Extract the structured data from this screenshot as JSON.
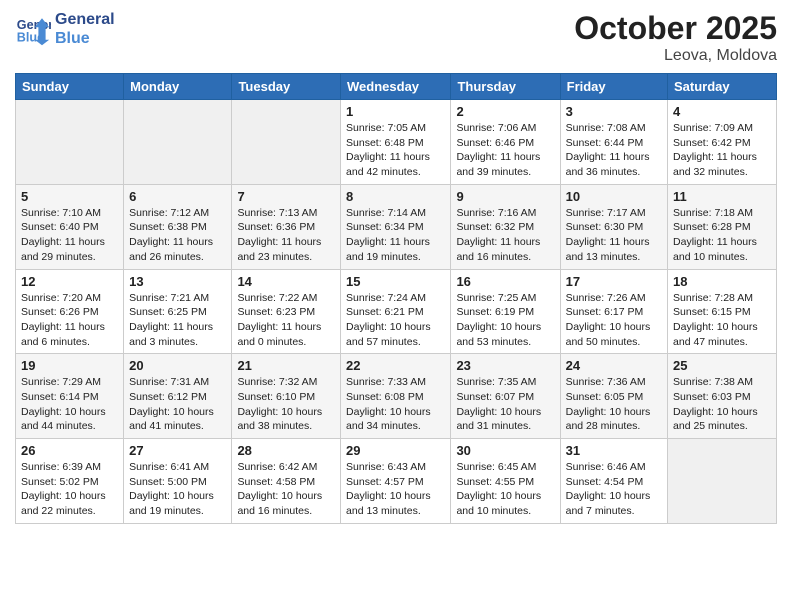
{
  "header": {
    "logo_general": "General",
    "logo_blue": "Blue",
    "month_year": "October 2025",
    "location": "Leova, Moldova"
  },
  "days_of_week": [
    "Sunday",
    "Monday",
    "Tuesday",
    "Wednesday",
    "Thursday",
    "Friday",
    "Saturday"
  ],
  "weeks": [
    [
      {
        "day": "",
        "info": ""
      },
      {
        "day": "",
        "info": ""
      },
      {
        "day": "",
        "info": ""
      },
      {
        "day": "1",
        "info": "Sunrise: 7:05 AM\nSunset: 6:48 PM\nDaylight: 11 hours and 42 minutes."
      },
      {
        "day": "2",
        "info": "Sunrise: 7:06 AM\nSunset: 6:46 PM\nDaylight: 11 hours and 39 minutes."
      },
      {
        "day": "3",
        "info": "Sunrise: 7:08 AM\nSunset: 6:44 PM\nDaylight: 11 hours and 36 minutes."
      },
      {
        "day": "4",
        "info": "Sunrise: 7:09 AM\nSunset: 6:42 PM\nDaylight: 11 hours and 32 minutes."
      }
    ],
    [
      {
        "day": "5",
        "info": "Sunrise: 7:10 AM\nSunset: 6:40 PM\nDaylight: 11 hours and 29 minutes."
      },
      {
        "day": "6",
        "info": "Sunrise: 7:12 AM\nSunset: 6:38 PM\nDaylight: 11 hours and 26 minutes."
      },
      {
        "day": "7",
        "info": "Sunrise: 7:13 AM\nSunset: 6:36 PM\nDaylight: 11 hours and 23 minutes."
      },
      {
        "day": "8",
        "info": "Sunrise: 7:14 AM\nSunset: 6:34 PM\nDaylight: 11 hours and 19 minutes."
      },
      {
        "day": "9",
        "info": "Sunrise: 7:16 AM\nSunset: 6:32 PM\nDaylight: 11 hours and 16 minutes."
      },
      {
        "day": "10",
        "info": "Sunrise: 7:17 AM\nSunset: 6:30 PM\nDaylight: 11 hours and 13 minutes."
      },
      {
        "day": "11",
        "info": "Sunrise: 7:18 AM\nSunset: 6:28 PM\nDaylight: 11 hours and 10 minutes."
      }
    ],
    [
      {
        "day": "12",
        "info": "Sunrise: 7:20 AM\nSunset: 6:26 PM\nDaylight: 11 hours and 6 minutes."
      },
      {
        "day": "13",
        "info": "Sunrise: 7:21 AM\nSunset: 6:25 PM\nDaylight: 11 hours and 3 minutes."
      },
      {
        "day": "14",
        "info": "Sunrise: 7:22 AM\nSunset: 6:23 PM\nDaylight: 11 hours and 0 minutes."
      },
      {
        "day": "15",
        "info": "Sunrise: 7:24 AM\nSunset: 6:21 PM\nDaylight: 10 hours and 57 minutes."
      },
      {
        "day": "16",
        "info": "Sunrise: 7:25 AM\nSunset: 6:19 PM\nDaylight: 10 hours and 53 minutes."
      },
      {
        "day": "17",
        "info": "Sunrise: 7:26 AM\nSunset: 6:17 PM\nDaylight: 10 hours and 50 minutes."
      },
      {
        "day": "18",
        "info": "Sunrise: 7:28 AM\nSunset: 6:15 PM\nDaylight: 10 hours and 47 minutes."
      }
    ],
    [
      {
        "day": "19",
        "info": "Sunrise: 7:29 AM\nSunset: 6:14 PM\nDaylight: 10 hours and 44 minutes."
      },
      {
        "day": "20",
        "info": "Sunrise: 7:31 AM\nSunset: 6:12 PM\nDaylight: 10 hours and 41 minutes."
      },
      {
        "day": "21",
        "info": "Sunrise: 7:32 AM\nSunset: 6:10 PM\nDaylight: 10 hours and 38 minutes."
      },
      {
        "day": "22",
        "info": "Sunrise: 7:33 AM\nSunset: 6:08 PM\nDaylight: 10 hours and 34 minutes."
      },
      {
        "day": "23",
        "info": "Sunrise: 7:35 AM\nSunset: 6:07 PM\nDaylight: 10 hours and 31 minutes."
      },
      {
        "day": "24",
        "info": "Sunrise: 7:36 AM\nSunset: 6:05 PM\nDaylight: 10 hours and 28 minutes."
      },
      {
        "day": "25",
        "info": "Sunrise: 7:38 AM\nSunset: 6:03 PM\nDaylight: 10 hours and 25 minutes."
      }
    ],
    [
      {
        "day": "26",
        "info": "Sunrise: 6:39 AM\nSunset: 5:02 PM\nDaylight: 10 hours and 22 minutes."
      },
      {
        "day": "27",
        "info": "Sunrise: 6:41 AM\nSunset: 5:00 PM\nDaylight: 10 hours and 19 minutes."
      },
      {
        "day": "28",
        "info": "Sunrise: 6:42 AM\nSunset: 4:58 PM\nDaylight: 10 hours and 16 minutes."
      },
      {
        "day": "29",
        "info": "Sunrise: 6:43 AM\nSunset: 4:57 PM\nDaylight: 10 hours and 13 minutes."
      },
      {
        "day": "30",
        "info": "Sunrise: 6:45 AM\nSunset: 4:55 PM\nDaylight: 10 hours and 10 minutes."
      },
      {
        "day": "31",
        "info": "Sunrise: 6:46 AM\nSunset: 4:54 PM\nDaylight: 10 hours and 7 minutes."
      },
      {
        "day": "",
        "info": ""
      }
    ]
  ]
}
